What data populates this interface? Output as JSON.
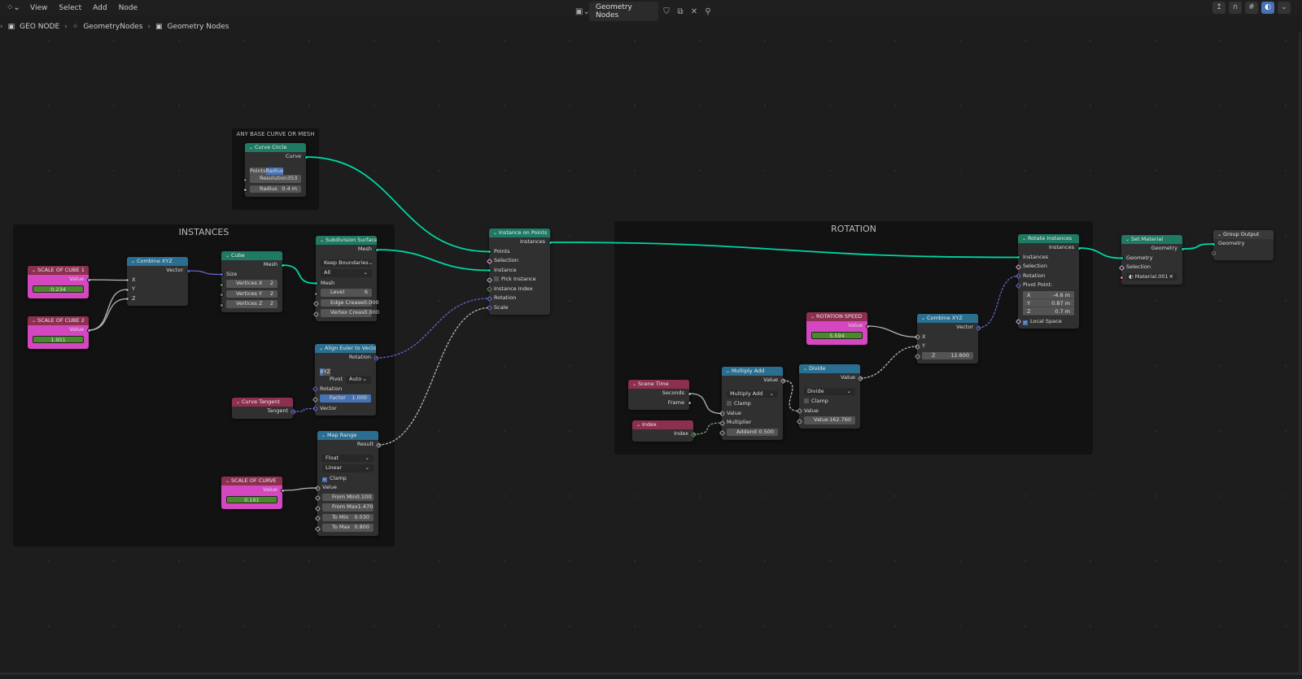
{
  "topbar": {
    "menus": [
      "View",
      "Select",
      "Add",
      "Node"
    ],
    "node_tree_name": "Geometry Nodes"
  },
  "breadcrumb": [
    "GEO NODE",
    "GeometryNodes",
    "Geometry Nodes"
  ],
  "frames": [
    {
      "id": "f_base",
      "label": "ANY BASE CURVE OR MESH"
    },
    {
      "id": "f_inst",
      "label": "INSTANCES"
    },
    {
      "id": "f_rot",
      "label": "ROTATION"
    }
  ],
  "colors": {
    "geometry": "#1f7a63",
    "converter": "#2a6f91",
    "input": "#8d2f50",
    "output": "#3a3a3a",
    "pink_body": "#d447c0",
    "socket_geometry": "#00d6a3",
    "socket_float": "#a1a1a1",
    "socket_vector": "#6363c7",
    "socket_int": "#598c5c",
    "socket_bool": "#cca6d6",
    "socket_material": "#eb7582"
  },
  "nodes": [
    {
      "id": "curve_circle",
      "title": "Curve Circle",
      "cat": "geometry",
      "rows": [
        {
          "t": "out",
          "l": "Curve",
          "s": "geo"
        },
        {
          "t": "spacer"
        },
        {
          "t": "toggle",
          "opts": [
            "Points",
            "Radius"
          ],
          "active": 1
        },
        {
          "t": "field",
          "l": "Resolution",
          "v": "353",
          "s": "int"
        },
        {
          "t": "field",
          "l": "Radius",
          "v": "0.4 m",
          "s": "float"
        }
      ]
    },
    {
      "id": "scale1",
      "title": "SCALE OF CUBE 1",
      "cat": "input",
      "pink": true,
      "rows": [
        {
          "t": "out",
          "l": "Value",
          "s": "float"
        },
        {
          "t": "slider",
          "v": "0.234"
        }
      ]
    },
    {
      "id": "scale2",
      "title": "SCALE OF CUBE 2",
      "cat": "input",
      "pink": true,
      "rows": [
        {
          "t": "out",
          "l": "Value",
          "s": "float"
        },
        {
          "t": "slider",
          "v": "1.951"
        }
      ]
    },
    {
      "id": "combine1",
      "title": "Combine XYZ",
      "cat": "converter",
      "rows": [
        {
          "t": "out",
          "l": "Vector",
          "s": "vec"
        },
        {
          "t": "in",
          "l": "X",
          "s": "float"
        },
        {
          "t": "in",
          "l": "Y",
          "s": "float"
        },
        {
          "t": "in",
          "l": "Z",
          "s": "float"
        }
      ]
    },
    {
      "id": "cube",
      "title": "Cube",
      "cat": "geometry",
      "rows": [
        {
          "t": "out",
          "l": "Mesh",
          "s": "geo"
        },
        {
          "t": "in",
          "l": "Size",
          "s": "vec"
        },
        {
          "t": "field",
          "l": "Vertices X",
          "v": "2",
          "s": "int"
        },
        {
          "t": "field",
          "l": "Vertices Y",
          "v": "2",
          "s": "int"
        },
        {
          "t": "field",
          "l": "Vertices Z",
          "v": "2",
          "s": "int"
        }
      ]
    },
    {
      "id": "subsurf",
      "title": "Subdivision Surface",
      "cat": "geometry",
      "rows": [
        {
          "t": "out",
          "l": "Mesh",
          "s": "geo"
        },
        {
          "t": "spacer"
        },
        {
          "t": "dd",
          "l": "Keep Boundaries"
        },
        {
          "t": "dd",
          "l": "All"
        },
        {
          "t": "in",
          "l": "Mesh",
          "s": "geo"
        },
        {
          "t": "field",
          "l": "Level",
          "v": "6",
          "s": "int"
        },
        {
          "t": "field",
          "l": "Edge Crease",
          "v": "0.000",
          "s": "float",
          "d": true
        },
        {
          "t": "field",
          "l": "Vertex Creas",
          "v": "0.000",
          "s": "float",
          "d": true
        }
      ]
    },
    {
      "id": "align",
      "title": "Align Euler to Vector",
      "cat": "converter",
      "rows": [
        {
          "t": "out",
          "l": "Rotation",
          "s": "vec",
          "d": true
        },
        {
          "t": "spacer"
        },
        {
          "t": "toggle",
          "opts": [
            "X",
            "Y",
            "Z"
          ],
          "active": 0
        },
        {
          "t": "ddl",
          "l": "Pivot",
          "v": "Auto"
        },
        {
          "t": "in",
          "l": "Rotation",
          "s": "vec",
          "d": true
        },
        {
          "t": "field",
          "l": "Factor",
          "v": "1.000",
          "s": "float",
          "d": true,
          "blue": true
        },
        {
          "t": "in",
          "l": "Vector",
          "s": "vec",
          "d": true
        }
      ]
    },
    {
      "id": "tangent",
      "title": "Curve Tangent",
      "cat": "input",
      "rows": [
        {
          "t": "out",
          "l": "Tangent",
          "s": "vec",
          "d": true
        }
      ]
    },
    {
      "id": "maprange",
      "title": "Map Range",
      "cat": "converter",
      "rows": [
        {
          "t": "out",
          "l": "Result",
          "s": "float",
          "d": true
        },
        {
          "t": "spacer"
        },
        {
          "t": "dd",
          "l": "Float"
        },
        {
          "t": "dd",
          "l": "Linear"
        },
        {
          "t": "check",
          "l": "Clamp",
          "on": true
        },
        {
          "t": "in",
          "l": "Value",
          "s": "float",
          "d": true
        },
        {
          "t": "field",
          "l": "From Min",
          "v": "0.100",
          "s": "float",
          "d": true
        },
        {
          "t": "field",
          "l": "From Max",
          "v": "1.470",
          "s": "float",
          "d": true
        },
        {
          "t": "field",
          "l": "To Min",
          "v": "0.030",
          "s": "float",
          "d": true
        },
        {
          "t": "field",
          "l": "To Max",
          "v": "0.800",
          "s": "float",
          "d": true
        }
      ]
    },
    {
      "id": "scalecurve",
      "title": "SCALE OF CURVE",
      "cat": "input",
      "pink": true,
      "rows": [
        {
          "t": "out",
          "l": "Value",
          "s": "float"
        },
        {
          "t": "slider",
          "v": "0.191"
        }
      ]
    },
    {
      "id": "iop",
      "title": "Instance on Points",
      "cat": "geometry",
      "rows": [
        {
          "t": "out",
          "l": "Instances",
          "s": "geo"
        },
        {
          "t": "in",
          "l": "Points",
          "s": "geo"
        },
        {
          "t": "in",
          "l": "Selection",
          "s": "bool",
          "d": true
        },
        {
          "t": "in",
          "l": "Instance",
          "s": "geo"
        },
        {
          "t": "check",
          "l": "Pick Instance",
          "on": false,
          "s": "bool",
          "d": true
        },
        {
          "t": "in",
          "l": "Instance Index",
          "s": "int",
          "d": true
        },
        {
          "t": "in",
          "l": "Rotation",
          "s": "vec",
          "d": true
        },
        {
          "t": "in",
          "l": "Scale",
          "s": "vec",
          "d": true
        }
      ]
    },
    {
      "id": "rotspeed",
      "title": "ROTATION SPEED",
      "cat": "input",
      "pink": true,
      "rows": [
        {
          "t": "out",
          "l": "Value",
          "s": "float"
        },
        {
          "t": "slider",
          "v": "5.594"
        }
      ]
    },
    {
      "id": "combine2",
      "title": "Combine XYZ",
      "cat": "converter",
      "rows": [
        {
          "t": "out",
          "l": "Vector",
          "s": "vec",
          "d": true
        },
        {
          "t": "in",
          "l": "X",
          "s": "float",
          "d": true
        },
        {
          "t": "in",
          "l": "Y",
          "s": "float",
          "d": true
        },
        {
          "t": "field",
          "l": "Z",
          "v": "12.600",
          "s": "float",
          "d": true
        }
      ]
    },
    {
      "id": "scenetime",
      "title": "Scene Time",
      "cat": "input",
      "rows": [
        {
          "t": "out",
          "l": "Seconds",
          "s": "float"
        },
        {
          "t": "out",
          "l": "Frame",
          "s": "float"
        }
      ]
    },
    {
      "id": "index",
      "title": "Index",
      "cat": "input",
      "rows": [
        {
          "t": "out",
          "l": "Index",
          "s": "int",
          "d": true
        }
      ]
    },
    {
      "id": "muladd",
      "title": "Multiply Add",
      "cat": "converter",
      "rows": [
        {
          "t": "out",
          "l": "Value",
          "s": "float",
          "d": true
        },
        {
          "t": "spacer"
        },
        {
          "t": "dd",
          "l": "Multiply Add"
        },
        {
          "t": "check",
          "l": "Clamp",
          "on": false
        },
        {
          "t": "in",
          "l": "Value",
          "s": "float",
          "d": true
        },
        {
          "t": "in",
          "l": "Multiplier",
          "s": "float",
          "d": true
        },
        {
          "t": "field",
          "l": "Addend",
          "v": "0.500",
          "s": "float",
          "d": true
        }
      ]
    },
    {
      "id": "divide",
      "title": "Divide",
      "cat": "converter",
      "rows": [
        {
          "t": "out",
          "l": "Value",
          "s": "float",
          "d": true
        },
        {
          "t": "spacer"
        },
        {
          "t": "dd",
          "l": "Divide"
        },
        {
          "t": "check",
          "l": "Clamp",
          "on": false
        },
        {
          "t": "in",
          "l": "Value",
          "s": "float",
          "d": true
        },
        {
          "t": "field",
          "l": "Value",
          "v": "162.760",
          "s": "float",
          "d": true
        }
      ]
    },
    {
      "id": "rotinst",
      "title": "Rotate Instances",
      "cat": "geometry",
      "rows": [
        {
          "t": "out",
          "l": "Instances",
          "s": "geo"
        },
        {
          "t": "in",
          "l": "Instances",
          "s": "geo"
        },
        {
          "t": "in",
          "l": "Selection",
          "s": "bool",
          "d": true
        },
        {
          "t": "in",
          "l": "Rotation",
          "s": "vec",
          "d": true
        },
        {
          "t": "in",
          "l": "Pivot Point:",
          "s": "vec",
          "d": true
        },
        {
          "t": "vec",
          "items": [
            [
              "X",
              "-4.6 m"
            ],
            [
              "Y",
              "0.87 m"
            ],
            [
              "Z",
              "0.7 m"
            ]
          ]
        },
        {
          "t": "check",
          "l": "Local Space",
          "on": true,
          "s": "bool",
          "d": true
        }
      ]
    },
    {
      "id": "setmat",
      "title": "Set Material",
      "cat": "geometry",
      "rows": [
        {
          "t": "out",
          "l": "Geometry",
          "s": "geo"
        },
        {
          "t": "in",
          "l": "Geometry",
          "s": "geo"
        },
        {
          "t": "in",
          "l": "Selection",
          "s": "bool",
          "d": true
        },
        {
          "t": "mat",
          "v": "Material.001",
          "s": "mat"
        }
      ]
    },
    {
      "id": "groupout",
      "title": "Group Output",
      "cat": "output",
      "rows": [
        {
          "t": "in",
          "l": "Geometry",
          "s": "geo"
        },
        {
          "t": "in",
          "l": "",
          "s": "empty"
        }
      ]
    }
  ],
  "links": [
    [
      "curve_circle",
      0,
      "iop",
      1
    ],
    [
      "subsurf",
      0,
      "iop",
      3
    ],
    [
      "cube",
      0,
      "subsurf",
      4
    ],
    [
      "combine1",
      0,
      "cube",
      1
    ],
    [
      "scale1",
      0,
      "combine1",
      1
    ],
    [
      "scale2",
      0,
      "combine1",
      2
    ],
    [
      "scale2",
      0,
      "combine1",
      3
    ],
    [
      "tangent",
      0,
      "align",
      6
    ],
    [
      "align",
      0,
      "iop",
      6
    ],
    [
      "maprange",
      0,
      "iop",
      7
    ],
    [
      "scalecurve",
      0,
      "maprange",
      5
    ],
    [
      "iop",
      0,
      "rotinst",
      1
    ],
    [
      "rotinst",
      0,
      "setmat",
      1
    ],
    [
      "setmat",
      0,
      "groupout",
      0
    ],
    [
      "rotspeed",
      0,
      "combine2",
      1
    ],
    [
      "divide",
      0,
      "combine2",
      2
    ],
    [
      "combine2",
      0,
      "rotinst",
      3
    ],
    [
      "scenetime",
      0,
      "muladd",
      4
    ],
    [
      "index",
      0,
      "muladd",
      5
    ],
    [
      "muladd",
      0,
      "divide",
      4
    ]
  ]
}
